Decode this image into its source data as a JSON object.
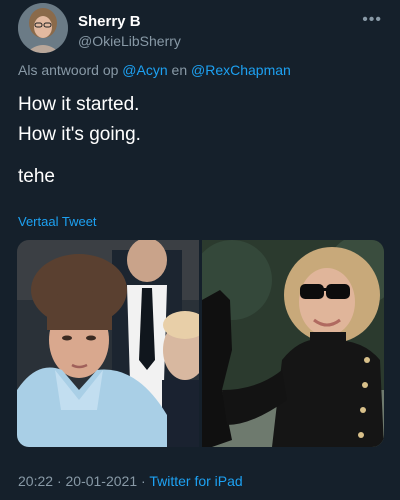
{
  "author": {
    "display_name": "Sherry B",
    "handle": "@OkieLibSherry"
  },
  "more_icon": "more-horizontal-icon",
  "reply": {
    "prefix": "Als antwoord op",
    "mention_1": "@Acyn",
    "conjunction": "en",
    "mention_2": "@RexChapman"
  },
  "tweet": {
    "lines": [
      "How it started.",
      "How it's going.",
      "tehe"
    ]
  },
  "translate_label": "Vertaal Tweet",
  "meta": {
    "time": "20:22",
    "separator": "·",
    "date": "20-01-2021",
    "source": "Twitter for iPad"
  },
  "colors": {
    "background": "#15202b",
    "text": "#ffffff",
    "muted": "#8899a6",
    "accent": "#1da1f2"
  }
}
